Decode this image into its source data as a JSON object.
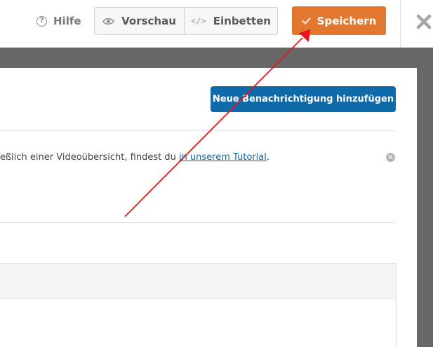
{
  "header": {
    "help_label": "Hilfe",
    "preview_label": "Vorschau",
    "embed_label": "Einbetten",
    "save_label": "Speichern",
    "help_icon": "question-circle-icon",
    "preview_icon": "eye-icon",
    "embed_icon": "code-icon",
    "save_icon": "checkmark-icon",
    "close_icon": "close-icon"
  },
  "panel": {
    "add_notification_label": "Neue Benachrichtigung hinzufügen",
    "notice": {
      "text_before": "eßlich einer Videoübersicht, findest du ",
      "link_text": "in unserem Tutorial",
      "text_after": "."
    }
  },
  "colors": {
    "save_button": "#e27730",
    "primary_button": "#0e6aa8",
    "backdrop": "#686868",
    "annotation_arrow": "#e8161c"
  }
}
